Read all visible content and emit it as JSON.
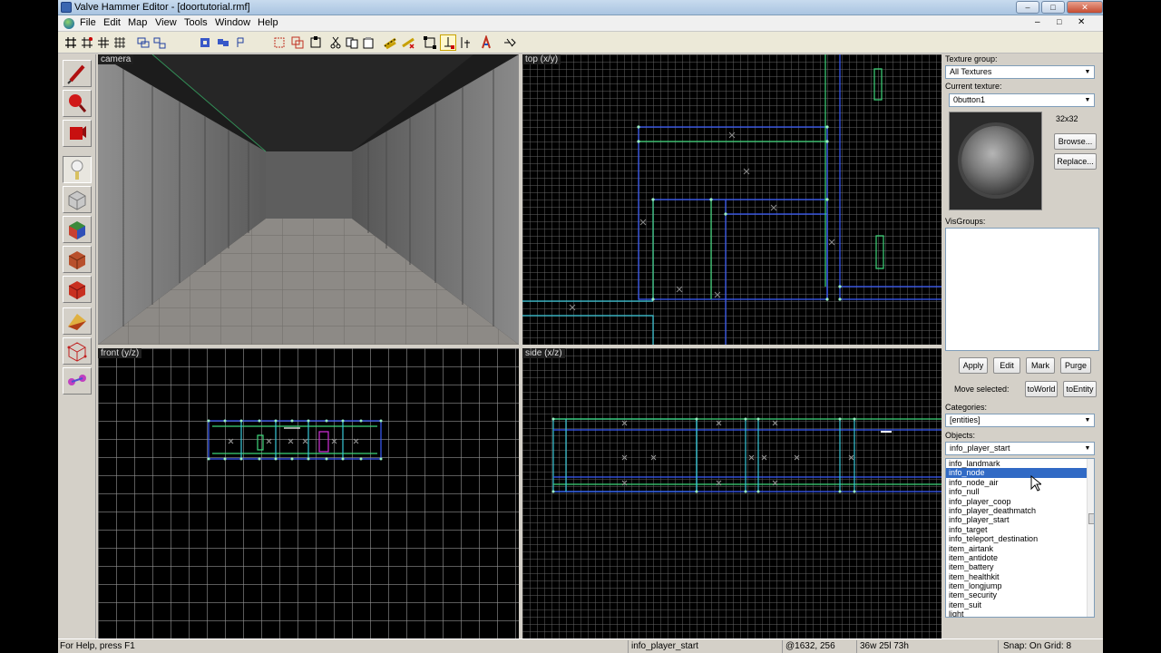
{
  "window": {
    "title": "Valve Hammer Editor - [doortutorial.rmf]",
    "minimize_label": "–",
    "restore_label": "□",
    "close_label": "✕"
  },
  "inner_controls": {
    "minimize": "–",
    "restore": "□",
    "close": "✕"
  },
  "menu": {
    "items": [
      "File",
      "Edit",
      "Map",
      "View",
      "Tools",
      "Window",
      "Help"
    ]
  },
  "toolbar_icons": [
    "grid-icon",
    "grid-toggle-icon",
    "smaller-grid-icon",
    "larger-grid-icon",
    "group-icon",
    "ungroup-icon",
    "carve-icon",
    "hollow-icon",
    "hide-icon",
    "cordon-icon",
    "copy-icon",
    "paste-icon",
    "cut-icon",
    "undo-icon",
    "redo-icon",
    "texture-lock-icon",
    "texture-apply-icon",
    "vertex-icon",
    "select-icon",
    "clip-icon",
    "entity-icon",
    "run-map-icon"
  ],
  "left_tools": [
    "selection-tool-icon",
    "magnify-tool-icon",
    "camera-tool-icon",
    "entity-tool-icon",
    "block-tool-icon",
    "texture-application-icon",
    "apply-texture-icon",
    "decal-tool-icon",
    "clipping-tool-icon",
    "vertex-manipulation-icon",
    "path-tool-icon"
  ],
  "viewports": {
    "camera": "camera",
    "top": "top (x/y)",
    "front": "front (y/z)",
    "side": "side (x/z)"
  },
  "panel": {
    "texture_group_label": "Texture group:",
    "texture_group_value": "All Textures",
    "current_texture_label": "Current texture:",
    "current_texture_value": "0button1",
    "texture_size": "32x32",
    "browse_label": "Browse...",
    "replace_label": "Replace...",
    "visgroups_label": "VisGroups:",
    "apply_label": "Apply",
    "edit_label": "Edit",
    "mark_label": "Mark",
    "purge_label": "Purge",
    "move_selected_label": "Move selected:",
    "to_world_label": "toWorld",
    "to_entity_label": "toEntity",
    "categories_label": "Categories:",
    "categories_value": "[entities]",
    "objects_label": "Objects:",
    "objects_value": "info_player_start",
    "objects_list": [
      "info_landmark",
      "info_node",
      "info_node_air",
      "info_null",
      "info_player_coop",
      "info_player_deathmatch",
      "info_player_start",
      "info_target",
      "info_teleport_destination",
      "item_airtank",
      "item_antidote",
      "item_battery",
      "item_healthkit",
      "item_longjump",
      "item_security",
      "item_suit",
      "light"
    ],
    "selected_object_index": 1
  },
  "status": {
    "help": "For Help, press F1",
    "object": "info_player_start",
    "coords": "@1632, 256",
    "size": "36w 25l 73h",
    "snap": "Snap: On Grid: 8"
  },
  "colors": {
    "wire_blue": "#3a5cff",
    "wire_green": "#3ed67a",
    "wire_cyan": "#37c7d8",
    "selection_blue": "#316ac5",
    "entity_magenta": "#d02fd8"
  }
}
